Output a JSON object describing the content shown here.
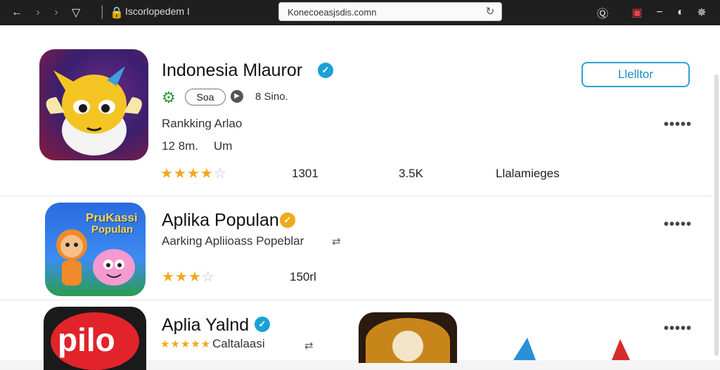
{
  "browser": {
    "url_display": "Iscorlopedem I",
    "address_value": "Konecoeasjsdis.comn",
    "icons": [
      "back-icon",
      "forward-icon",
      "shield-icon",
      "lock-icon",
      "reload-icon",
      "help-icon",
      "extension-icon",
      "menu-icon",
      "profile-icon",
      "settings-icon"
    ]
  },
  "apps": [
    {
      "title": "Indonesia Mlauror",
      "badge_color": "#1aa1d6",
      "pill": "Soa",
      "size": "8 Sino.",
      "category": "Rankking Arlao",
      "meta_left": "12 8m.",
      "meta_right": "Um",
      "rating": 4,
      "stat1": "1301",
      "stat2": "3.5K",
      "stat3": "Llalamieges",
      "install_label": "Llelltor"
    },
    {
      "title": "Aplika Populan",
      "badge_color": "#f2a81d",
      "icon_text_1": "PruKassi",
      "icon_text_2": "Populan",
      "category": "Aarking Apliioass Popeblar",
      "rating": 3,
      "stat1": "150rl"
    },
    {
      "title": "Aplia Yalnd",
      "badge_color": "#1aa1d6",
      "icon_text": "pilo",
      "category": "Caltalaasi",
      "rating": 5
    }
  ]
}
